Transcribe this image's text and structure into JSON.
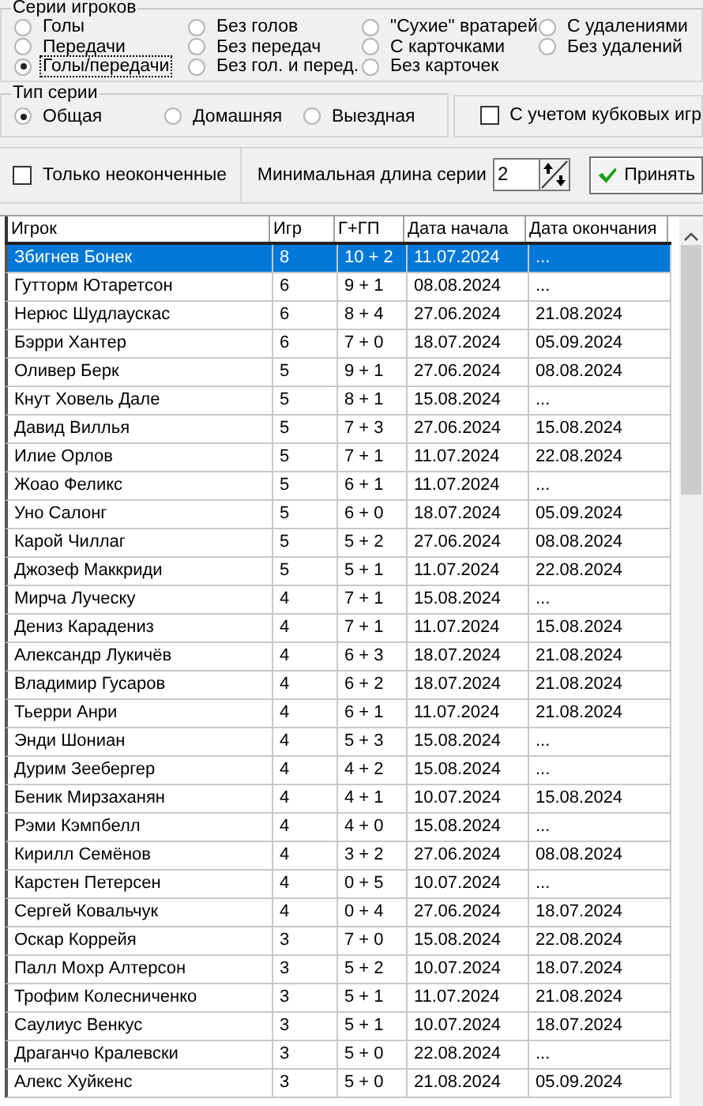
{
  "player_series": {
    "title": "Серии игроков",
    "options": [
      {
        "label": "Голы",
        "selected": false
      },
      {
        "label": "Передачи",
        "selected": false
      },
      {
        "label": "Голы/передачи",
        "selected": true
      },
      {
        "label": "Без голов",
        "selected": false
      },
      {
        "label": "Без передач",
        "selected": false
      },
      {
        "label": "Без гол. и перед.",
        "selected": false
      },
      {
        "label": "\"Сухие\" вратарей",
        "selected": false
      },
      {
        "label": "С карточками",
        "selected": false
      },
      {
        "label": "Без карточек",
        "selected": false
      },
      {
        "label": "С удалениями",
        "selected": false
      },
      {
        "label": "Без удалений",
        "selected": false
      }
    ]
  },
  "series_type": {
    "title": "Тип серии",
    "options": [
      {
        "label": "Общая",
        "selected": true
      },
      {
        "label": "Домашняя",
        "selected": false
      },
      {
        "label": "Выездная",
        "selected": false
      }
    ]
  },
  "cup_games": {
    "label": "С учетом кубковых игр",
    "checked": false
  },
  "unfinished_only": {
    "label": "Только неоконченные",
    "checked": false
  },
  "min_length": {
    "label": "Минимальная длина серии",
    "value": "2"
  },
  "apply_button": {
    "label": "Принять"
  },
  "table": {
    "columns": [
      "Игрок",
      "Игр",
      "Г+ГП",
      "Дата начала",
      "Дата окончания"
    ],
    "rows": [
      {
        "cells": [
          "Збигнев Бонек",
          "8",
          "10 + 2",
          "11.07.2024",
          "..."
        ],
        "selected": true
      },
      {
        "cells": [
          "Гутторм Ютаретсон",
          "6",
          "9 + 1",
          "08.08.2024",
          "..."
        ],
        "selected": false
      },
      {
        "cells": [
          "Нерюс Шудлаускас",
          "6",
          "8 + 4",
          "27.06.2024",
          "21.08.2024"
        ],
        "selected": false
      },
      {
        "cells": [
          "Бэрри Хантер",
          "6",
          "7 + 0",
          "18.07.2024",
          "05.09.2024"
        ],
        "selected": false
      },
      {
        "cells": [
          "Оливер Берк",
          "5",
          "9 + 1",
          "27.06.2024",
          "08.08.2024"
        ],
        "selected": false
      },
      {
        "cells": [
          "Кнут Ховель Дале",
          "5",
          "8 + 1",
          "15.08.2024",
          "..."
        ],
        "selected": false
      },
      {
        "cells": [
          "Давид Виллья",
          "5",
          "7 + 3",
          "27.06.2024",
          "15.08.2024"
        ],
        "selected": false
      },
      {
        "cells": [
          "Илие Орлов",
          "5",
          "7 + 1",
          "11.07.2024",
          "22.08.2024"
        ],
        "selected": false
      },
      {
        "cells": [
          "Жоао Феликс",
          "5",
          "6 + 1",
          "11.07.2024",
          "..."
        ],
        "selected": false
      },
      {
        "cells": [
          "Уно Салонг",
          "5",
          "6 + 0",
          "18.07.2024",
          "05.09.2024"
        ],
        "selected": false
      },
      {
        "cells": [
          "Карой Чиллаг",
          "5",
          "5 + 2",
          "27.06.2024",
          "08.08.2024"
        ],
        "selected": false
      },
      {
        "cells": [
          "Джозеф Маккриди",
          "5",
          "5 + 1",
          "11.07.2024",
          "22.08.2024"
        ],
        "selected": false
      },
      {
        "cells": [
          "Мирча Луческу",
          "4",
          "7 + 1",
          "15.08.2024",
          "..."
        ],
        "selected": false
      },
      {
        "cells": [
          "Дениз Карадениз",
          "4",
          "7 + 1",
          "11.07.2024",
          "15.08.2024"
        ],
        "selected": false
      },
      {
        "cells": [
          "Александр Лукичёв",
          "4",
          "6 + 3",
          "18.07.2024",
          "21.08.2024"
        ],
        "selected": false
      },
      {
        "cells": [
          "Владимир Гусаров",
          "4",
          "6 + 2",
          "18.07.2024",
          "21.08.2024"
        ],
        "selected": false
      },
      {
        "cells": [
          "Тьерри Анри",
          "4",
          "6 + 1",
          "11.07.2024",
          "21.08.2024"
        ],
        "selected": false
      },
      {
        "cells": [
          "Энди Шониан",
          "4",
          "5 + 3",
          "15.08.2024",
          "..."
        ],
        "selected": false
      },
      {
        "cells": [
          "Дурим Зеебергер",
          "4",
          "4 + 2",
          "15.08.2024",
          "..."
        ],
        "selected": false
      },
      {
        "cells": [
          "Беник Мирзаханян",
          "4",
          "4 + 1",
          "10.07.2024",
          "15.08.2024"
        ],
        "selected": false
      },
      {
        "cells": [
          "Рэми Кэмпбелл",
          "4",
          "4 + 0",
          "15.08.2024",
          "..."
        ],
        "selected": false
      },
      {
        "cells": [
          "Кирилл Семёнов",
          "4",
          "3 + 2",
          "27.06.2024",
          "08.08.2024"
        ],
        "selected": false
      },
      {
        "cells": [
          "Карстен Петерсен",
          "4",
          "0 + 5",
          "10.07.2024",
          "..."
        ],
        "selected": false
      },
      {
        "cells": [
          "Сергей Ковальчук",
          "4",
          "0 + 4",
          "27.06.2024",
          "18.07.2024"
        ],
        "selected": false
      },
      {
        "cells": [
          "Оскар Коррейя",
          "3",
          "7 + 0",
          "15.08.2024",
          "22.08.2024"
        ],
        "selected": false
      },
      {
        "cells": [
          "Палл Мохр Алтерсон",
          "3",
          "5 + 2",
          "10.07.2024",
          "18.07.2024"
        ],
        "selected": false
      },
      {
        "cells": [
          "Трофим Колесниченко",
          "3",
          "5 + 1",
          "11.07.2024",
          "21.08.2024"
        ],
        "selected": false
      },
      {
        "cells": [
          "Саулиус Венкус",
          "3",
          "5 + 1",
          "10.07.2024",
          "18.07.2024"
        ],
        "selected": false
      },
      {
        "cells": [
          "Драганчо Кралевски",
          "3",
          "5 + 0",
          "22.08.2024",
          "..."
        ],
        "selected": false
      },
      {
        "cells": [
          "Алекс Хуйкенс",
          "3",
          "5 + 0",
          "21.08.2024",
          "05.09.2024"
        ],
        "selected": false
      }
    ]
  }
}
